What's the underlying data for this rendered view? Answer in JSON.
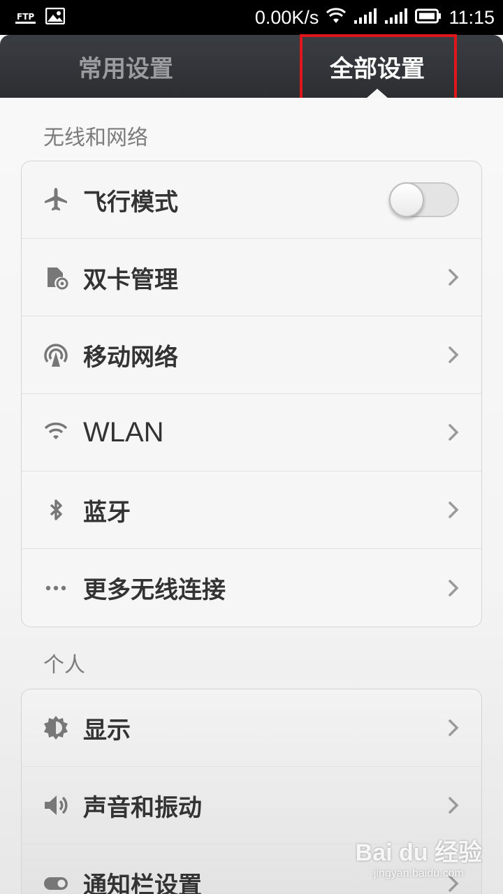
{
  "status_bar": {
    "left_icons": [
      "ftp-icon",
      "image-icon"
    ],
    "ftp_label": "FTP",
    "network_speed": "0.00K/s",
    "time": "11:15",
    "right_icons": [
      "wifi-icon",
      "signal-icon",
      "signal-icon",
      "battery-icon"
    ]
  },
  "tabs": [
    {
      "label": "常用设置",
      "active": false
    },
    {
      "label": "全部设置",
      "active": true
    }
  ],
  "highlight_color": "#e0161d",
  "sections": [
    {
      "title": "无线和网络",
      "items": [
        {
          "label": "飞行模式",
          "icon": "airplane-icon",
          "control": "toggle",
          "toggle_on": false
        },
        {
          "label": "双卡管理",
          "icon": "sim-card-icon",
          "control": "chevron"
        },
        {
          "label": "移动网络",
          "icon": "mobile-network-icon",
          "control": "chevron"
        },
        {
          "label": "WLAN",
          "icon": "wifi-icon",
          "control": "chevron"
        },
        {
          "label": "蓝牙",
          "icon": "bluetooth-icon",
          "control": "chevron"
        },
        {
          "label": "更多无线连接",
          "icon": "more-icon",
          "control": "chevron"
        }
      ]
    },
    {
      "title": "个人",
      "items": [
        {
          "label": "显示",
          "icon": "brightness-icon",
          "control": "chevron"
        },
        {
          "label": "声音和振动",
          "icon": "sound-icon",
          "control": "chevron"
        },
        {
          "label": "通知栏设置",
          "icon": "notification-toggle-icon",
          "control": "chevron"
        }
      ]
    }
  ],
  "watermark": {
    "logo": "Bai du 经验",
    "url": "jingyan.baidu.com"
  }
}
